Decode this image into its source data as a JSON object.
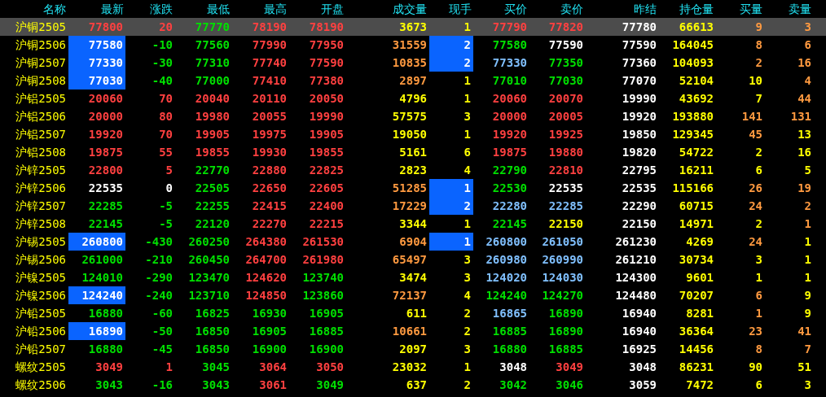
{
  "table": {
    "name_column": "名称",
    "columns": [
      "最新",
      "涨跌",
      "最低",
      "最高",
      "开盘",
      "成交量",
      "现手",
      "买价",
      "卖价",
      "昨结",
      "持仓量",
      "买量",
      "卖量"
    ],
    "rows": [
      {
        "name": "沪铜2505",
        "selected": true,
        "latest_highlighted": false,
        "lot_highlighted": false,
        "cells": [
          {
            "text": "77800",
            "color": "#ff4040"
          },
          {
            "text": "20",
            "color": "#ff4040"
          },
          {
            "text": "77770",
            "color": "#00e000"
          },
          {
            "text": "78190",
            "color": "#ff4040"
          },
          {
            "text": "78190",
            "color": "#ff4040"
          },
          {
            "text": "3673",
            "color": "#ffff00"
          },
          {
            "text": "1",
            "color": "#ffff00"
          },
          {
            "text": "77790",
            "color": "#ff4040"
          },
          {
            "text": "77820",
            "color": "#ff4040"
          },
          {
            "text": "77780",
            "color": "#ffffff"
          },
          {
            "text": "66613",
            "color": "#ffff00"
          },
          {
            "text": "9",
            "color": "#ff9a40"
          },
          {
            "text": "3",
            "color": "#ff9a40"
          }
        ]
      },
      {
        "name": "沪铜2506",
        "selected": false,
        "latest_highlighted": true,
        "lot_highlighted": true,
        "cells": [
          {
            "text": "77580",
            "color": "#ffffff"
          },
          {
            "text": "-10",
            "color": "#00e000"
          },
          {
            "text": "77560",
            "color": "#00e000"
          },
          {
            "text": "77990",
            "color": "#ff4040"
          },
          {
            "text": "77950",
            "color": "#ff4040"
          },
          {
            "text": "31559",
            "color": "#ff9a40"
          },
          {
            "text": "2",
            "color": "#ffffff"
          },
          {
            "text": "77580",
            "color": "#00e000"
          },
          {
            "text": "77590",
            "color": "#ffffff"
          },
          {
            "text": "77590",
            "color": "#ffffff"
          },
          {
            "text": "164045",
            "color": "#ffff00"
          },
          {
            "text": "8",
            "color": "#ff9a40"
          },
          {
            "text": "6",
            "color": "#ff9a40"
          }
        ]
      },
      {
        "name": "沪铜2507",
        "selected": false,
        "latest_highlighted": true,
        "lot_highlighted": true,
        "cells": [
          {
            "text": "77330",
            "color": "#ffffff"
          },
          {
            "text": "-30",
            "color": "#00e000"
          },
          {
            "text": "77310",
            "color": "#00e000"
          },
          {
            "text": "77740",
            "color": "#ff4040"
          },
          {
            "text": "77590",
            "color": "#ff4040"
          },
          {
            "text": "10835",
            "color": "#ff9a40"
          },
          {
            "text": "2",
            "color": "#ffffff"
          },
          {
            "text": "77330",
            "color": "#80c0ff"
          },
          {
            "text": "77350",
            "color": "#00e000"
          },
          {
            "text": "77360",
            "color": "#ffffff"
          },
          {
            "text": "104093",
            "color": "#ffff00"
          },
          {
            "text": "2",
            "color": "#ff9a40"
          },
          {
            "text": "16",
            "color": "#ff9a40"
          }
        ]
      },
      {
        "name": "沪铜2508",
        "selected": false,
        "latest_highlighted": true,
        "lot_highlighted": false,
        "cells": [
          {
            "text": "77030",
            "color": "#ffffff"
          },
          {
            "text": "-40",
            "color": "#00e000"
          },
          {
            "text": "77000",
            "color": "#00e000"
          },
          {
            "text": "77410",
            "color": "#ff4040"
          },
          {
            "text": "77380",
            "color": "#ff4040"
          },
          {
            "text": "2897",
            "color": "#ff9a40"
          },
          {
            "text": "1",
            "color": "#ffff00"
          },
          {
            "text": "77010",
            "color": "#00e000"
          },
          {
            "text": "77030",
            "color": "#00e000"
          },
          {
            "text": "77070",
            "color": "#ffffff"
          },
          {
            "text": "52104",
            "color": "#ffff00"
          },
          {
            "text": "10",
            "color": "#ffff00"
          },
          {
            "text": "4",
            "color": "#ff9a40"
          }
        ]
      },
      {
        "name": "沪铝2505",
        "selected": false,
        "latest_highlighted": false,
        "lot_highlighted": false,
        "cells": [
          {
            "text": "20060",
            "color": "#ff4040"
          },
          {
            "text": "70",
            "color": "#ff4040"
          },
          {
            "text": "20040",
            "color": "#ff4040"
          },
          {
            "text": "20110",
            "color": "#ff4040"
          },
          {
            "text": "20050",
            "color": "#ff4040"
          },
          {
            "text": "4796",
            "color": "#ffff00"
          },
          {
            "text": "1",
            "color": "#ffff00"
          },
          {
            "text": "20060",
            "color": "#ff4040"
          },
          {
            "text": "20070",
            "color": "#ff4040"
          },
          {
            "text": "19990",
            "color": "#ffffff"
          },
          {
            "text": "43692",
            "color": "#ffff00"
          },
          {
            "text": "7",
            "color": "#ffff00"
          },
          {
            "text": "44",
            "color": "#ff9a40"
          }
        ]
      },
      {
        "name": "沪铝2506",
        "selected": false,
        "latest_highlighted": false,
        "lot_highlighted": false,
        "cells": [
          {
            "text": "20000",
            "color": "#ff4040"
          },
          {
            "text": "80",
            "color": "#ff4040"
          },
          {
            "text": "19980",
            "color": "#ff4040"
          },
          {
            "text": "20055",
            "color": "#ff4040"
          },
          {
            "text": "19990",
            "color": "#ff4040"
          },
          {
            "text": "57575",
            "color": "#ffff00"
          },
          {
            "text": "3",
            "color": "#ffff00"
          },
          {
            "text": "20000",
            "color": "#ff4040"
          },
          {
            "text": "20005",
            "color": "#ff4040"
          },
          {
            "text": "19920",
            "color": "#ffffff"
          },
          {
            "text": "193880",
            "color": "#ffff00"
          },
          {
            "text": "141",
            "color": "#ff9a40"
          },
          {
            "text": "131",
            "color": "#ff9a40"
          }
        ]
      },
      {
        "name": "沪铝2507",
        "selected": false,
        "latest_highlighted": false,
        "lot_highlighted": false,
        "cells": [
          {
            "text": "19920",
            "color": "#ff4040"
          },
          {
            "text": "70",
            "color": "#ff4040"
          },
          {
            "text": "19905",
            "color": "#ff4040"
          },
          {
            "text": "19975",
            "color": "#ff4040"
          },
          {
            "text": "19905",
            "color": "#ff4040"
          },
          {
            "text": "19050",
            "color": "#ffff00"
          },
          {
            "text": "1",
            "color": "#ffff00"
          },
          {
            "text": "19920",
            "color": "#ff4040"
          },
          {
            "text": "19925",
            "color": "#ff4040"
          },
          {
            "text": "19850",
            "color": "#ffffff"
          },
          {
            "text": "129345",
            "color": "#ffff00"
          },
          {
            "text": "45",
            "color": "#ff9a40"
          },
          {
            "text": "13",
            "color": "#ffff00"
          }
        ]
      },
      {
        "name": "沪铝2508",
        "selected": false,
        "latest_highlighted": false,
        "lot_highlighted": false,
        "cells": [
          {
            "text": "19875",
            "color": "#ff4040"
          },
          {
            "text": "55",
            "color": "#ff4040"
          },
          {
            "text": "19855",
            "color": "#ff4040"
          },
          {
            "text": "19930",
            "color": "#ff4040"
          },
          {
            "text": "19855",
            "color": "#ff4040"
          },
          {
            "text": "5161",
            "color": "#ffff00"
          },
          {
            "text": "6",
            "color": "#ffff00"
          },
          {
            "text": "19875",
            "color": "#ff4040"
          },
          {
            "text": "19880",
            "color": "#ff4040"
          },
          {
            "text": "19820",
            "color": "#ffffff"
          },
          {
            "text": "54722",
            "color": "#ffff00"
          },
          {
            "text": "2",
            "color": "#ffff00"
          },
          {
            "text": "16",
            "color": "#ffff00"
          }
        ]
      },
      {
        "name": "沪锌2505",
        "selected": false,
        "latest_highlighted": false,
        "lot_highlighted": false,
        "cells": [
          {
            "text": "22800",
            "color": "#ff4040"
          },
          {
            "text": "5",
            "color": "#ff4040"
          },
          {
            "text": "22770",
            "color": "#00e000"
          },
          {
            "text": "22880",
            "color": "#ff4040"
          },
          {
            "text": "22825",
            "color": "#ff4040"
          },
          {
            "text": "2823",
            "color": "#ffff00"
          },
          {
            "text": "4",
            "color": "#ffff00"
          },
          {
            "text": "22790",
            "color": "#00e000"
          },
          {
            "text": "22810",
            "color": "#ff4040"
          },
          {
            "text": "22795",
            "color": "#ffffff"
          },
          {
            "text": "16211",
            "color": "#ffff00"
          },
          {
            "text": "6",
            "color": "#ffff00"
          },
          {
            "text": "5",
            "color": "#ffff00"
          }
        ]
      },
      {
        "name": "沪锌2506",
        "selected": false,
        "latest_highlighted": false,
        "lot_highlighted": true,
        "cells": [
          {
            "text": "22535",
            "color": "#ffffff"
          },
          {
            "text": "0",
            "color": "#ffffff"
          },
          {
            "text": "22505",
            "color": "#00e000"
          },
          {
            "text": "22650",
            "color": "#ff4040"
          },
          {
            "text": "22605",
            "color": "#ff4040"
          },
          {
            "text": "51285",
            "color": "#ff9a40"
          },
          {
            "text": "1",
            "color": "#ffffff"
          },
          {
            "text": "22530",
            "color": "#00e000"
          },
          {
            "text": "22535",
            "color": "#ffffff"
          },
          {
            "text": "22535",
            "color": "#ffffff"
          },
          {
            "text": "115166",
            "color": "#ffff00"
          },
          {
            "text": "26",
            "color": "#ff9a40"
          },
          {
            "text": "19",
            "color": "#ff9a40"
          }
        ]
      },
      {
        "name": "沪锌2507",
        "selected": false,
        "latest_highlighted": false,
        "lot_highlighted": true,
        "cells": [
          {
            "text": "22285",
            "color": "#00e000"
          },
          {
            "text": "-5",
            "color": "#00e000"
          },
          {
            "text": "22255",
            "color": "#00e000"
          },
          {
            "text": "22415",
            "color": "#ff4040"
          },
          {
            "text": "22400",
            "color": "#ff4040"
          },
          {
            "text": "17229",
            "color": "#ff9a40"
          },
          {
            "text": "2",
            "color": "#ffffff"
          },
          {
            "text": "22280",
            "color": "#80c0ff"
          },
          {
            "text": "22285",
            "color": "#80c0ff"
          },
          {
            "text": "22290",
            "color": "#ffffff"
          },
          {
            "text": "60715",
            "color": "#ffff00"
          },
          {
            "text": "24",
            "color": "#ff9a40"
          },
          {
            "text": "2",
            "color": "#ff9a40"
          }
        ]
      },
      {
        "name": "沪锌2508",
        "selected": false,
        "latest_highlighted": false,
        "lot_highlighted": false,
        "cells": [
          {
            "text": "22145",
            "color": "#00e000"
          },
          {
            "text": "-5",
            "color": "#00e000"
          },
          {
            "text": "22120",
            "color": "#00e000"
          },
          {
            "text": "22270",
            "color": "#ff4040"
          },
          {
            "text": "22215",
            "color": "#ff4040"
          },
          {
            "text": "3344",
            "color": "#ffff00"
          },
          {
            "text": "1",
            "color": "#ffff00"
          },
          {
            "text": "22145",
            "color": "#00e000"
          },
          {
            "text": "22150",
            "color": "#ffff00"
          },
          {
            "text": "22150",
            "color": "#ffffff"
          },
          {
            "text": "14971",
            "color": "#ffff00"
          },
          {
            "text": "2",
            "color": "#ffff00"
          },
          {
            "text": "1",
            "color": "#ff9a40"
          }
        ]
      },
      {
        "name": "沪锡2505",
        "selected": false,
        "latest_highlighted": true,
        "lot_highlighted": true,
        "cells": [
          {
            "text": "260800",
            "color": "#ffffff"
          },
          {
            "text": "-430",
            "color": "#00e000"
          },
          {
            "text": "260250",
            "color": "#00e000"
          },
          {
            "text": "264380",
            "color": "#ff4040"
          },
          {
            "text": "261530",
            "color": "#ff4040"
          },
          {
            "text": "6904",
            "color": "#ff9a40"
          },
          {
            "text": "1",
            "color": "#ffffff"
          },
          {
            "text": "260800",
            "color": "#80c0ff"
          },
          {
            "text": "261050",
            "color": "#80c0ff"
          },
          {
            "text": "261230",
            "color": "#ffffff"
          },
          {
            "text": "4269",
            "color": "#ffff00"
          },
          {
            "text": "24",
            "color": "#ff9a40"
          },
          {
            "text": "1",
            "color": "#ffff00"
          }
        ]
      },
      {
        "name": "沪锡2506",
        "selected": false,
        "latest_highlighted": false,
        "lot_highlighted": false,
        "cells": [
          {
            "text": "261000",
            "color": "#00e000"
          },
          {
            "text": "-210",
            "color": "#00e000"
          },
          {
            "text": "260450",
            "color": "#00e000"
          },
          {
            "text": "264700",
            "color": "#ff4040"
          },
          {
            "text": "261980",
            "color": "#ff4040"
          },
          {
            "text": "65497",
            "color": "#ff9a40"
          },
          {
            "text": "3",
            "color": "#ffff00"
          },
          {
            "text": "260980",
            "color": "#80c0ff"
          },
          {
            "text": "260990",
            "color": "#80c0ff"
          },
          {
            "text": "261210",
            "color": "#ffffff"
          },
          {
            "text": "30734",
            "color": "#ffff00"
          },
          {
            "text": "3",
            "color": "#ffff00"
          },
          {
            "text": "1",
            "color": "#ffff00"
          }
        ]
      },
      {
        "name": "沪镍2505",
        "selected": false,
        "latest_highlighted": false,
        "lot_highlighted": false,
        "cells": [
          {
            "text": "124010",
            "color": "#00e000"
          },
          {
            "text": "-290",
            "color": "#00e000"
          },
          {
            "text": "123470",
            "color": "#00e000"
          },
          {
            "text": "124620",
            "color": "#ff4040"
          },
          {
            "text": "123740",
            "color": "#00e000"
          },
          {
            "text": "3474",
            "color": "#ffff00"
          },
          {
            "text": "3",
            "color": "#ffff00"
          },
          {
            "text": "124020",
            "color": "#80c0ff"
          },
          {
            "text": "124030",
            "color": "#80c0ff"
          },
          {
            "text": "124300",
            "color": "#ffffff"
          },
          {
            "text": "9601",
            "color": "#ffff00"
          },
          {
            "text": "1",
            "color": "#ffff00"
          },
          {
            "text": "1",
            "color": "#ffff00"
          }
        ]
      },
      {
        "name": "沪镍2506",
        "selected": false,
        "latest_highlighted": true,
        "lot_highlighted": false,
        "cells": [
          {
            "text": "124240",
            "color": "#ffffff"
          },
          {
            "text": "-240",
            "color": "#00e000"
          },
          {
            "text": "123710",
            "color": "#00e000"
          },
          {
            "text": "124850",
            "color": "#ff4040"
          },
          {
            "text": "123860",
            "color": "#00e000"
          },
          {
            "text": "72137",
            "color": "#ff9a40"
          },
          {
            "text": "4",
            "color": "#ffff00"
          },
          {
            "text": "124240",
            "color": "#00e000"
          },
          {
            "text": "124270",
            "color": "#00e000"
          },
          {
            "text": "124480",
            "color": "#ffffff"
          },
          {
            "text": "70207",
            "color": "#ffff00"
          },
          {
            "text": "6",
            "color": "#ff9a40"
          },
          {
            "text": "9",
            "color": "#ffff00"
          }
        ]
      },
      {
        "name": "沪铅2505",
        "selected": false,
        "latest_highlighted": false,
        "lot_highlighted": false,
        "cells": [
          {
            "text": "16880",
            "color": "#00e000"
          },
          {
            "text": "-60",
            "color": "#00e000"
          },
          {
            "text": "16825",
            "color": "#00e000"
          },
          {
            "text": "16930",
            "color": "#00e000"
          },
          {
            "text": "16905",
            "color": "#00e000"
          },
          {
            "text": "611",
            "color": "#ffff00"
          },
          {
            "text": "2",
            "color": "#ffff00"
          },
          {
            "text": "16865",
            "color": "#80c0ff"
          },
          {
            "text": "16890",
            "color": "#00e000"
          },
          {
            "text": "16940",
            "color": "#ffffff"
          },
          {
            "text": "8281",
            "color": "#ffff00"
          },
          {
            "text": "1",
            "color": "#ff9a40"
          },
          {
            "text": "9",
            "color": "#ffff00"
          }
        ]
      },
      {
        "name": "沪铅2506",
        "selected": false,
        "latest_highlighted": true,
        "lot_highlighted": false,
        "cells": [
          {
            "text": "16890",
            "color": "#ffffff"
          },
          {
            "text": "-50",
            "color": "#00e000"
          },
          {
            "text": "16850",
            "color": "#00e000"
          },
          {
            "text": "16905",
            "color": "#00e000"
          },
          {
            "text": "16885",
            "color": "#00e000"
          },
          {
            "text": "10661",
            "color": "#ff9a40"
          },
          {
            "text": "2",
            "color": "#ffff00"
          },
          {
            "text": "16885",
            "color": "#00e000"
          },
          {
            "text": "16890",
            "color": "#00e000"
          },
          {
            "text": "16940",
            "color": "#ffffff"
          },
          {
            "text": "36364",
            "color": "#ffff00"
          },
          {
            "text": "23",
            "color": "#ff9a40"
          },
          {
            "text": "41",
            "color": "#ff9a40"
          }
        ]
      },
      {
        "name": "沪铅2507",
        "selected": false,
        "latest_highlighted": false,
        "lot_highlighted": false,
        "cells": [
          {
            "text": "16880",
            "color": "#00e000"
          },
          {
            "text": "-45",
            "color": "#00e000"
          },
          {
            "text": "16850",
            "color": "#00e000"
          },
          {
            "text": "16900",
            "color": "#00e000"
          },
          {
            "text": "16900",
            "color": "#00e000"
          },
          {
            "text": "2097",
            "color": "#ffff00"
          },
          {
            "text": "3",
            "color": "#ffff00"
          },
          {
            "text": "16880",
            "color": "#00e000"
          },
          {
            "text": "16885",
            "color": "#00e000"
          },
          {
            "text": "16925",
            "color": "#ffffff"
          },
          {
            "text": "14456",
            "color": "#ffff00"
          },
          {
            "text": "8",
            "color": "#ff9a40"
          },
          {
            "text": "7",
            "color": "#ff9a40"
          }
        ]
      },
      {
        "name": "螺纹2505",
        "selected": false,
        "latest_highlighted": false,
        "lot_highlighted": false,
        "cells": [
          {
            "text": "3049",
            "color": "#ff4040"
          },
          {
            "text": "1",
            "color": "#ff4040"
          },
          {
            "text": "3045",
            "color": "#00e000"
          },
          {
            "text": "3064",
            "color": "#ff4040"
          },
          {
            "text": "3050",
            "color": "#ff4040"
          },
          {
            "text": "23032",
            "color": "#ffff00"
          },
          {
            "text": "1",
            "color": "#ffff00"
          },
          {
            "text": "3048",
            "color": "#ffffff"
          },
          {
            "text": "3049",
            "color": "#ff4040"
          },
          {
            "text": "3048",
            "color": "#ffffff"
          },
          {
            "text": "86231",
            "color": "#ffff00"
          },
          {
            "text": "90",
            "color": "#ffff00"
          },
          {
            "text": "51",
            "color": "#ffff00"
          }
        ]
      },
      {
        "name": "螺纹2506",
        "selected": false,
        "latest_highlighted": false,
        "lot_highlighted": false,
        "cells": [
          {
            "text": "3043",
            "color": "#00e000"
          },
          {
            "text": "-16",
            "color": "#00e000"
          },
          {
            "text": "3043",
            "color": "#00e000"
          },
          {
            "text": "3061",
            "color": "#ff4040"
          },
          {
            "text": "3049",
            "color": "#00e000"
          },
          {
            "text": "637",
            "color": "#ffff00"
          },
          {
            "text": "2",
            "color": "#ffff00"
          },
          {
            "text": "3042",
            "color": "#00e000"
          },
          {
            "text": "3046",
            "color": "#00e000"
          },
          {
            "text": "3059",
            "color": "#ffffff"
          },
          {
            "text": "7472",
            "color": "#ffff00"
          },
          {
            "text": "6",
            "color": "#ffff00"
          },
          {
            "text": "3",
            "color": "#ffff00"
          }
        ]
      }
    ]
  }
}
